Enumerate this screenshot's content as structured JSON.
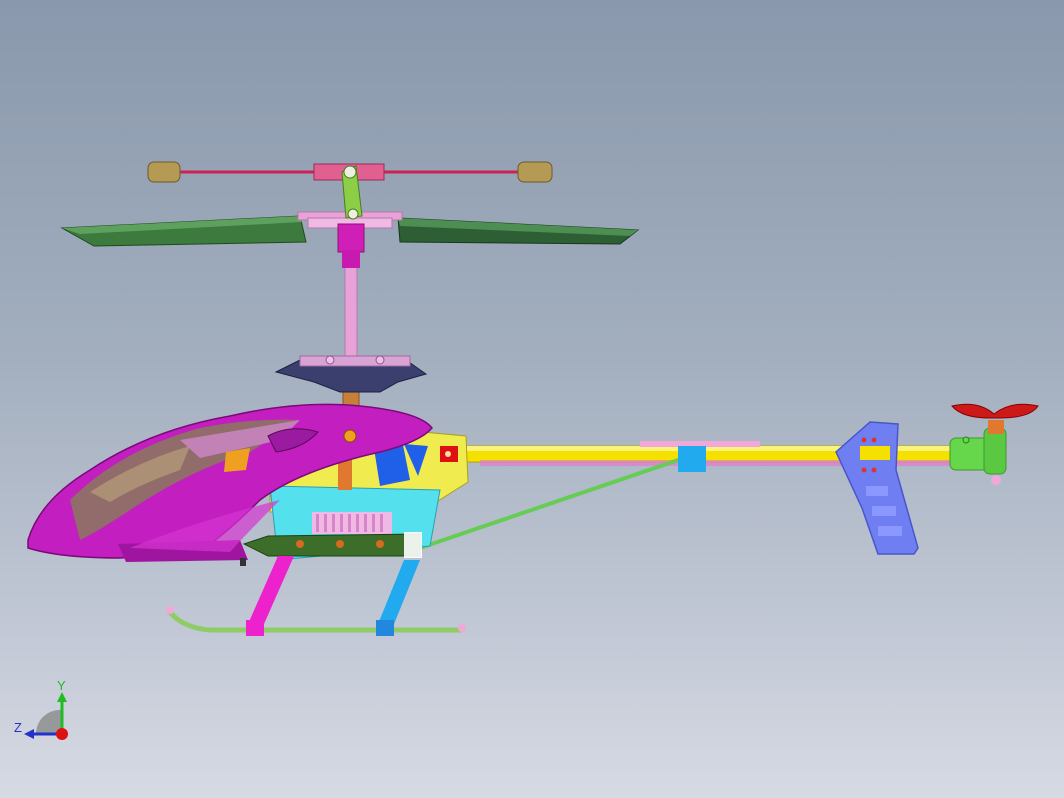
{
  "viewport": {
    "background_top": "#8998ac",
    "background_bottom": "#d6dae3"
  },
  "model": {
    "description_icon": "helicopter-cad-model",
    "colors": {
      "canopy": "#c21ec0",
      "canopy_glass": "#8a7a5a",
      "main_blade": "#3d7a3d",
      "flybar": "#cc2255",
      "flybar_weight": "#b49a55",
      "rotor_head": "#e28ad8",
      "swashplate": "#3a3f6e",
      "main_shaft": "#e8a2d8",
      "frame": "#f0ec50",
      "frame_lower": "#55e0ee",
      "tail_boom": "#f5e100",
      "tail_support": "#66cc55",
      "tail_fin": "#6f7ff2",
      "tail_gearbox": "#66d64a",
      "tail_rotor": "#cc1a1a",
      "landing_skid": "#90cc66",
      "skid_front_strut": "#ee22cc",
      "skid_rear_strut": "#22aaee",
      "battery": "#3c6e2a"
    }
  },
  "triad": {
    "y_label": "Y",
    "z_label": "Z",
    "y_color": "#22bb22",
    "z_color": "#2233cc",
    "x_color": "#dd1111"
  }
}
